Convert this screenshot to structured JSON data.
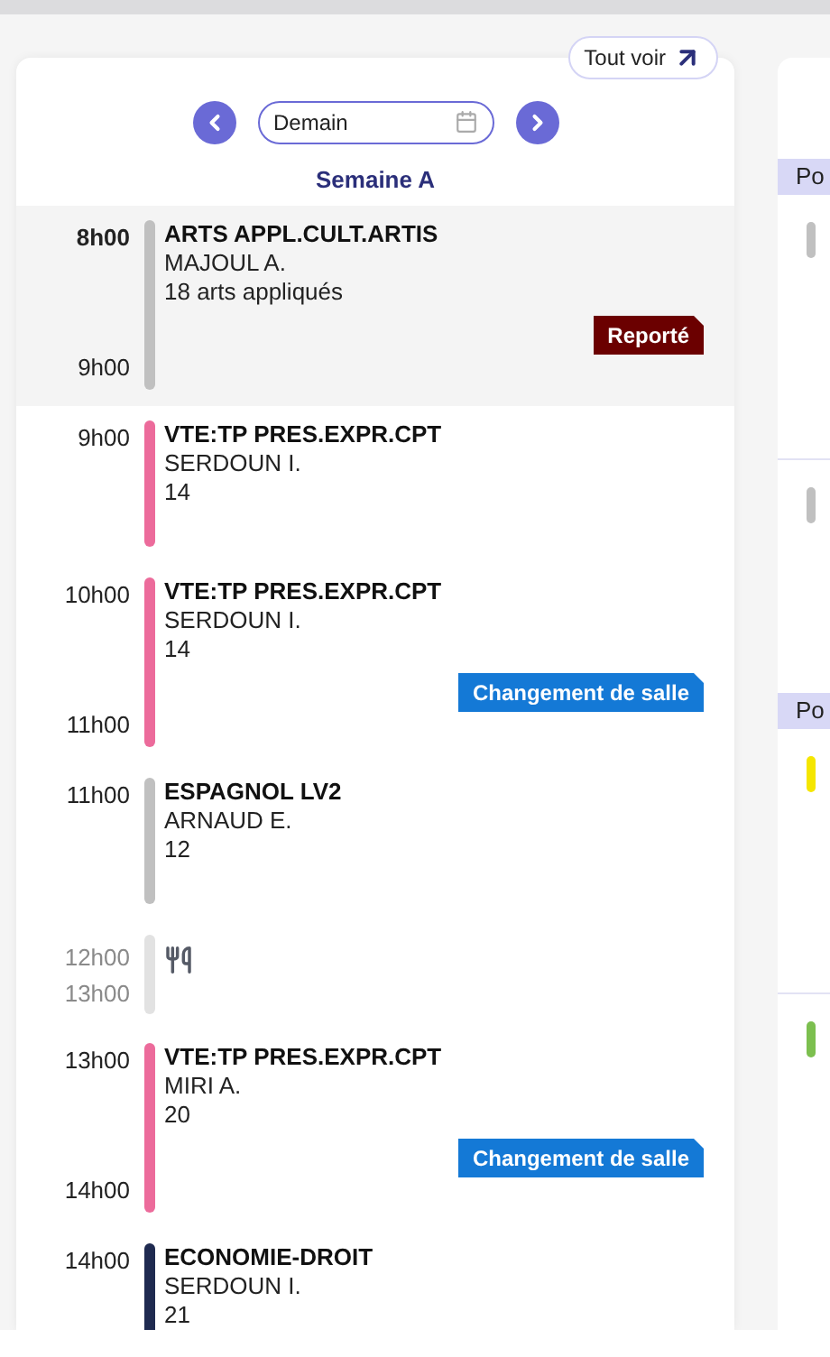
{
  "header": {
    "all_button": "Tout voir",
    "date_field": {
      "value": "Demain"
    },
    "week_label": "Semaine A"
  },
  "lessons": [
    {
      "kind": "lesson",
      "start": "8h00",
      "end": "9h00",
      "current": true,
      "color": "#c0c0c0",
      "subject": "ARTS APPL.CULT.ARTIS",
      "teacher": "MAJOUL A.",
      "room": "18 arts appliqués",
      "badge": {
        "kind": "postponed",
        "label": "Reporté"
      }
    },
    {
      "kind": "lesson",
      "start": "9h00",
      "current": false,
      "color": "#ec6b9b",
      "subject": "VTE:TP PRES.EXPR.CPT",
      "teacher": "SERDOUN I.",
      "room": "14"
    },
    {
      "kind": "lesson",
      "start": "10h00",
      "end": "11h00",
      "current": false,
      "color": "#ec6b9b",
      "subject": "VTE:TP PRES.EXPR.CPT",
      "teacher": "SERDOUN I.",
      "room": "14",
      "badge": {
        "kind": "room_change",
        "label": "Changement de salle"
      }
    },
    {
      "kind": "lesson",
      "start": "11h00",
      "current": false,
      "color": "#c0c0c0",
      "subject": "ESPAGNOL LV2",
      "teacher": "ARNAUD E.",
      "room": "12"
    },
    {
      "kind": "lunch",
      "start": "12h00",
      "end": "13h00"
    },
    {
      "kind": "lesson",
      "start": "13h00",
      "end": "14h00",
      "current": false,
      "color": "#ec6b9b",
      "subject": "VTE:TP PRES.EXPR.CPT",
      "teacher": "MIRI A.",
      "room": "20",
      "badge": {
        "kind": "room_change",
        "label": "Changement de salle"
      }
    },
    {
      "kind": "lesson",
      "start": "14h00",
      "current": false,
      "color": "#1f2a50",
      "subject": "ECONOMIE-DROIT",
      "teacher": "SERDOUN I.",
      "room": "21"
    }
  ],
  "side_panel": {
    "sections": [
      {
        "title": "Po",
        "items": [
          {
            "color": "#c0c0c0"
          },
          {
            "color": "#c0c0c0"
          }
        ]
      },
      {
        "title": "Po",
        "items": [
          {
            "color": "#f5e600"
          },
          {
            "color": "#7cbf4f"
          }
        ]
      }
    ]
  }
}
